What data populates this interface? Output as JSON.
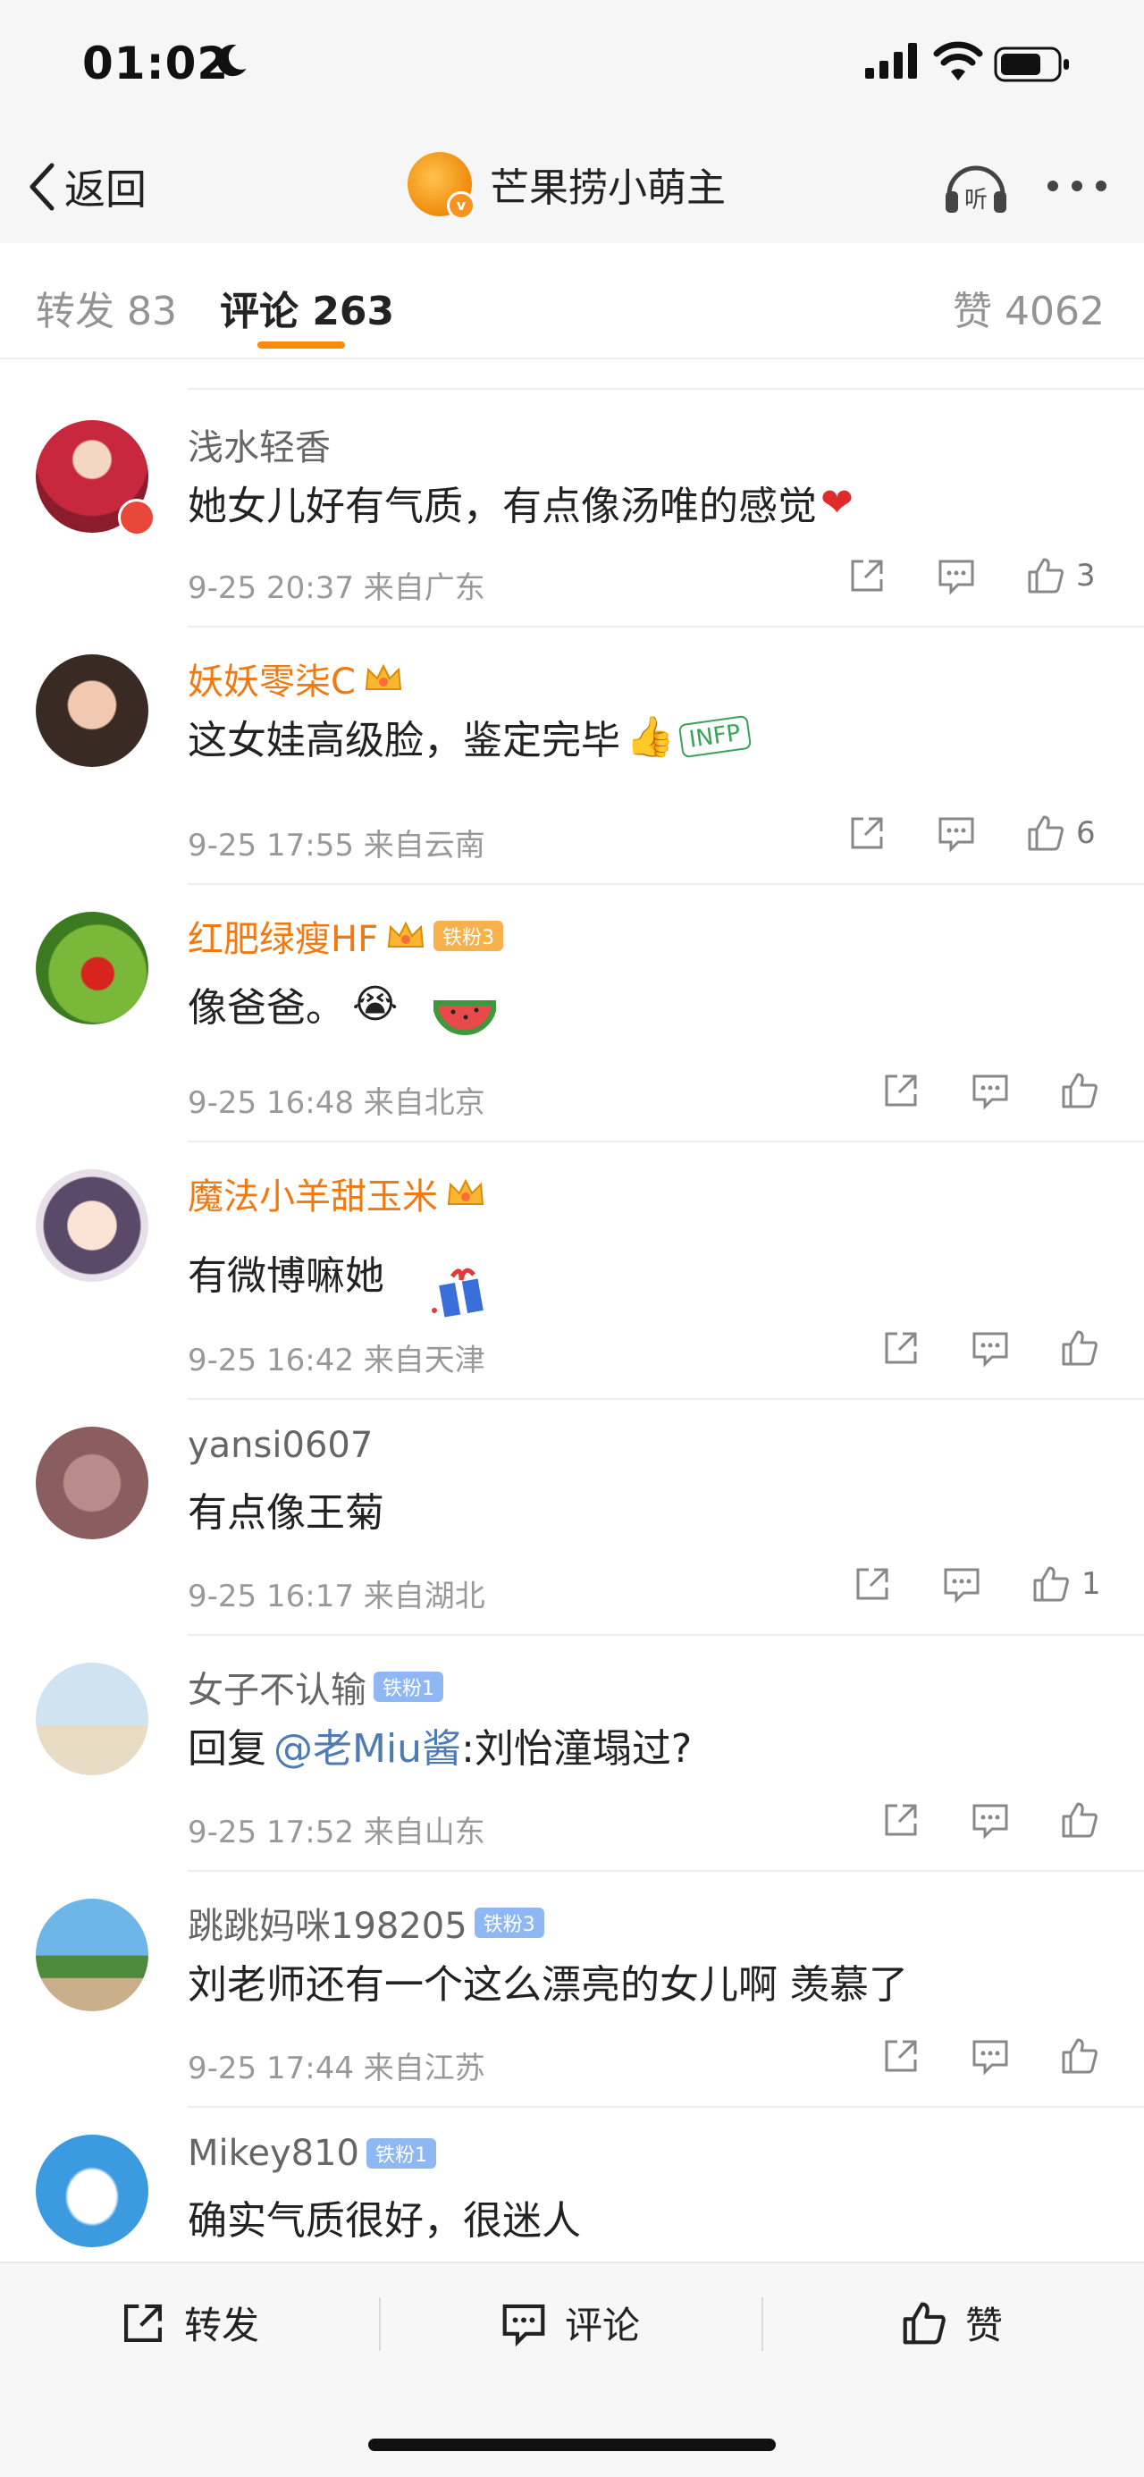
{
  "status": {
    "time": "01:02"
  },
  "nav": {
    "back_label": "返回",
    "title": "芒果捞小萌主",
    "listen_label": "听"
  },
  "tabs": {
    "repost": "转发 83",
    "comments": "评论 263",
    "likes": "赞 4062"
  },
  "comments": [
    {
      "username": "浅水轻香",
      "text": "她女儿好有气质，有点像汤唯的感觉",
      "emoji": "❤",
      "meta": "9-25 20:37  来自广东",
      "likes": "3"
    },
    {
      "username": "妖妖零柒C",
      "text": "这女娃高级脸，鉴定完毕",
      "emoji": "👍",
      "sticker": "INFP",
      "meta": "9-25 17:55  来自云南",
      "likes": "6"
    },
    {
      "username": "红肥绿瘦HF",
      "badge": "铁粉3",
      "text": "像爸爸。",
      "emoji": "😭",
      "meta": "9-25 16:48  来自北京",
      "likes": ""
    },
    {
      "username": "魔法小羊甜玉米",
      "text": "有微博嘛她",
      "meta": "9-25 16:42  来自天津",
      "likes": ""
    },
    {
      "username": "yansi0607",
      "text": "有点像王菊",
      "meta": "9-25 16:17  来自湖北",
      "likes": "1"
    },
    {
      "username": "女子不认输",
      "badge": "铁粉1",
      "text_prefix": "回复",
      "mention": "@老Miu酱",
      "text": ":刘怡潼塌过?",
      "meta": "9-25 17:52  来自山东",
      "likes": ""
    },
    {
      "username": "跳跳妈咪198205",
      "badge": "铁粉3",
      "text": "刘老师还有一个这么漂亮的女儿啊 羡慕了",
      "meta": "9-25 17:44  来自江苏",
      "likes": ""
    },
    {
      "username": "Mikey810",
      "badge": "铁粉1",
      "text": "确实气质很好，很迷人"
    }
  ],
  "bottom_bar": {
    "repost": "转发",
    "comment": "评论",
    "like": "赞"
  },
  "colors": {
    "accent": "#f98a0b",
    "vip_name": "#f07a11",
    "mention": "#4e7bb4",
    "meta": "#999999"
  }
}
